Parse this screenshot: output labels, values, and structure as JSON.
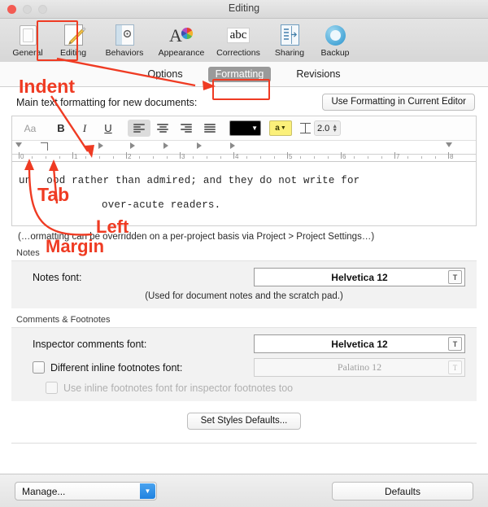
{
  "window": {
    "title": "Editing",
    "traffic_lights": [
      "close-red",
      "minimize-gray",
      "zoom-gray"
    ]
  },
  "prefs_toolbar": {
    "items": [
      {
        "label": "General",
        "icon": "document-icon",
        "selected": false
      },
      {
        "label": "Editing",
        "icon": "pencil-edit-icon",
        "selected": true
      },
      {
        "label": "Behaviors",
        "icon": "gear-window-icon",
        "selected": false
      },
      {
        "label": "Appearance",
        "icon": "color-wheel-icon",
        "selected": false
      },
      {
        "label": "Corrections",
        "icon": "abc-icon",
        "selected": false
      },
      {
        "label": "Sharing",
        "icon": "share-book-icon",
        "selected": false
      },
      {
        "label": "Backup",
        "icon": "backup-circle-icon",
        "selected": false
      }
    ]
  },
  "tabs": [
    {
      "label": "Options",
      "selected": false
    },
    {
      "label": "Formatting",
      "selected": true
    },
    {
      "label": "Revisions",
      "selected": false
    }
  ],
  "main": {
    "section_label": "Main text formatting for new documents:",
    "use_formatting_button": "Use Formatting in Current Editor",
    "format_toolbar": {
      "font_button": "Aa",
      "bold": "B",
      "italic": "I",
      "underline": "U",
      "align_left": "align-left-icon",
      "align_center": "align-center-icon",
      "align_right": "align-right-icon",
      "align_justify": "align-justify-icon",
      "text_color": "#000000",
      "highlight_color": "#fbf07a",
      "highlight_glyph": "a",
      "line_spacing_value": "2.0"
    },
    "ruler": {
      "numbers": [
        "0",
        "1",
        "2",
        "3",
        "4",
        "5",
        "6",
        "7",
        "8"
      ],
      "unit": "inches"
    },
    "preview": {
      "line1": "un       ood rather than admired; and they do not write for",
      "line2": "over-acute readers."
    },
    "hint": "(…ormatting can be overridden on a per-project basis via Project > Project Settings…)"
  },
  "notes": {
    "group_title": "Notes",
    "font_label": "Notes font:",
    "font_value": "Helvetica 12",
    "subnote": "(Used for document notes and the scratch pad.)"
  },
  "comments": {
    "group_title": "Comments & Footnotes",
    "inspector_label": "Inspector comments font:",
    "inspector_value": "Helvetica 12",
    "different_inline_label": "Different inline footnotes font:",
    "different_inline_checked": false,
    "inline_value": "Palatino 12",
    "use_inline_label": "Use inline footnotes font for inspector footnotes too",
    "use_inline_checked": false
  },
  "set_styles_button": "Set Styles Defaults...",
  "bottom": {
    "manage": "Manage...",
    "defaults": "Defaults"
  },
  "annotations": {
    "accent_color": "#ef3b23",
    "indent": "Indent",
    "tab": "Tab",
    "left": "Left",
    "margin": "Margin",
    "highlight_targets": [
      "Editing toolbar item",
      "Formatting tab"
    ]
  }
}
